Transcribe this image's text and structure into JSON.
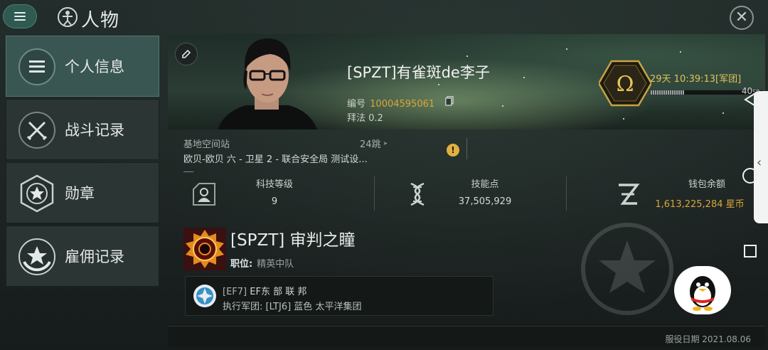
{
  "header": {
    "menu_icon": "hamburger-menu-icon",
    "title_icon": "character-icon",
    "title": "人物",
    "close_icon": "close-icon"
  },
  "sidebar": {
    "items": [
      {
        "label": "个人信息",
        "icon": "profile-list-icon",
        "active": true
      },
      {
        "label": "战斗记录",
        "icon": "crossed-swords-icon",
        "active": false
      },
      {
        "label": "勋章",
        "icon": "medal-star-icon",
        "active": false
      },
      {
        "label": "雇佣记录",
        "icon": "employment-star-icon",
        "active": false
      }
    ]
  },
  "profile": {
    "name": "[SPZT]有雀斑de李子",
    "id_label": "编号",
    "id_value": "10004595061",
    "worship": "拜法 0.2",
    "omega_time": "29天 10:39:13[军团]",
    "sp_value": "40",
    "sp_unit": "SP",
    "sp_fill_fraction": 0.3
  },
  "location": {
    "station_label": "基地空间站",
    "jumps": "24跳",
    "path": "欧贝-欧贝 六 - 卫星 2 - 联合安全局 测试设..."
  },
  "stats": [
    {
      "label": "科技等级",
      "value": "9",
      "icon": "tech-level-icon"
    },
    {
      "label": "技能点",
      "value": "37,505,929",
      "icon": "dna-skill-icon"
    },
    {
      "label": "钱包余额",
      "value": "1,613,225,284 星币",
      "icon": "wallet-z-icon"
    }
  ],
  "corporation": {
    "name": "[SPZT] 审判之瞳",
    "role_label": "职位:",
    "role_value": "精英中队"
  },
  "alliance": {
    "tag": "[EF7]",
    "name": "EF东 部 联 邦",
    "executor_label": "执行军团:",
    "executor": "[LTJ6] 蓝色 太平洋集团"
  },
  "service_date": "服役日期 2021.08.06",
  "colors": {
    "accent_gold": "#d9a63a",
    "active_tab": "#3a5652",
    "panel": "#2b3534"
  }
}
